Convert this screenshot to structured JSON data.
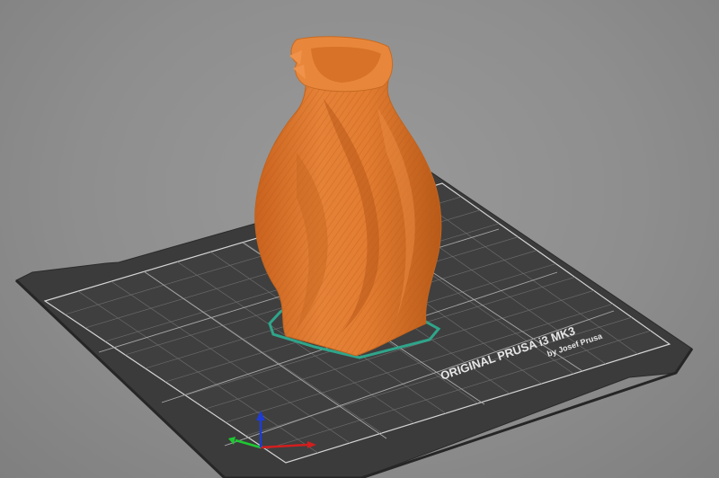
{
  "app": {
    "view": "3D Editor View"
  },
  "bed": {
    "brand_line1": "ORIGINAL PRUSA i3  MK3",
    "brand_line2": "by Josef Prusa"
  },
  "model": {
    "name": "twisted vase",
    "color": "#e07a2e"
  },
  "colors": {
    "background": "#8e8e8e",
    "bed_surface": "#3a3a3a",
    "bed_grid": "#6a6a6a",
    "bed_outline": "#cfcfcf",
    "model_orange": "#e07a2e",
    "model_shadow": "#b85a18",
    "skirt_teal": "#2fa58a",
    "axis_x": "#d21e1e",
    "axis_y": "#1ec832",
    "axis_z": "#1e3cd2"
  },
  "axes": {
    "icon_names": [
      "axis-x-arrow",
      "axis-y-arrow",
      "axis-z-arrow"
    ]
  }
}
